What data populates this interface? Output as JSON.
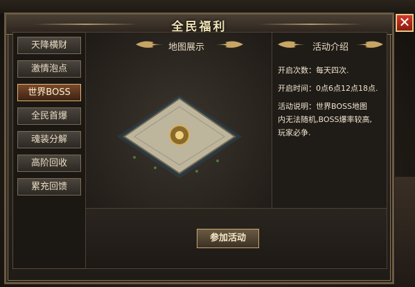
{
  "window": {
    "title": "全民福利",
    "close_symbol": "✕"
  },
  "sidebar": {
    "items": [
      {
        "label": "天降横财",
        "active": false
      },
      {
        "label": "激情泡点",
        "active": false
      },
      {
        "label": "世界BOSS",
        "active": true
      },
      {
        "label": "全民首爆",
        "active": false
      },
      {
        "label": "魂装分解",
        "active": false
      },
      {
        "label": "高阶回收",
        "active": false
      },
      {
        "label": "累充回馈",
        "active": false
      }
    ]
  },
  "map_section": {
    "title": "地图展示"
  },
  "info_section": {
    "title": "活动介绍",
    "lines": [
      "开启次数：每天四次.",
      "开启时间：0点6点12点18点.",
      "活动说明：世界BOSS地图",
      "内无法随机,BOSS爆率较高,",
      "玩家必争."
    ]
  },
  "actions": {
    "join_label": "参加活动"
  },
  "colors": {
    "accent_gold": "#e8c98a",
    "active_tab": "#7a4a2a",
    "close_red": "#d23a2a"
  }
}
